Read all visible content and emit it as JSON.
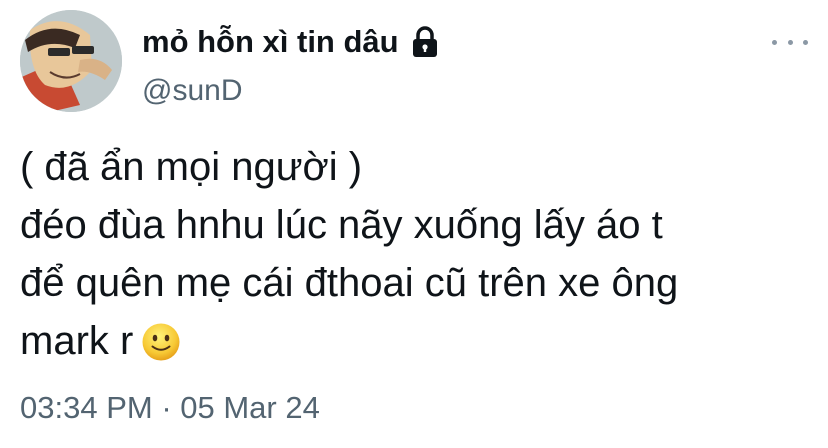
{
  "author": {
    "display_name": "mỏ hỗn xì tin dâu",
    "handle": "@sunD",
    "avatar_icon": "avatar-image",
    "protected_icon": "lock-icon"
  },
  "menu": {
    "icon": "more-horizontal-icon"
  },
  "tweet": {
    "lines": [
      "( đã ẩn mọi người )",
      "éo đùa hnhu lúc nãy xuống lấy áo t",
      "để quên mẹ cái đthoai cũ trên xe ông",
      "mark r"
    ],
    "first_line_prefix": "đ",
    "emoji": "slightly-smiling-face-icon"
  },
  "timestamp": {
    "time": "03:34 PM",
    "separator": " · ",
    "date": "05 Mar 24"
  },
  "colors": {
    "primary_text": "#0f1419",
    "secondary_text": "#536471",
    "background": "#ffffff"
  }
}
